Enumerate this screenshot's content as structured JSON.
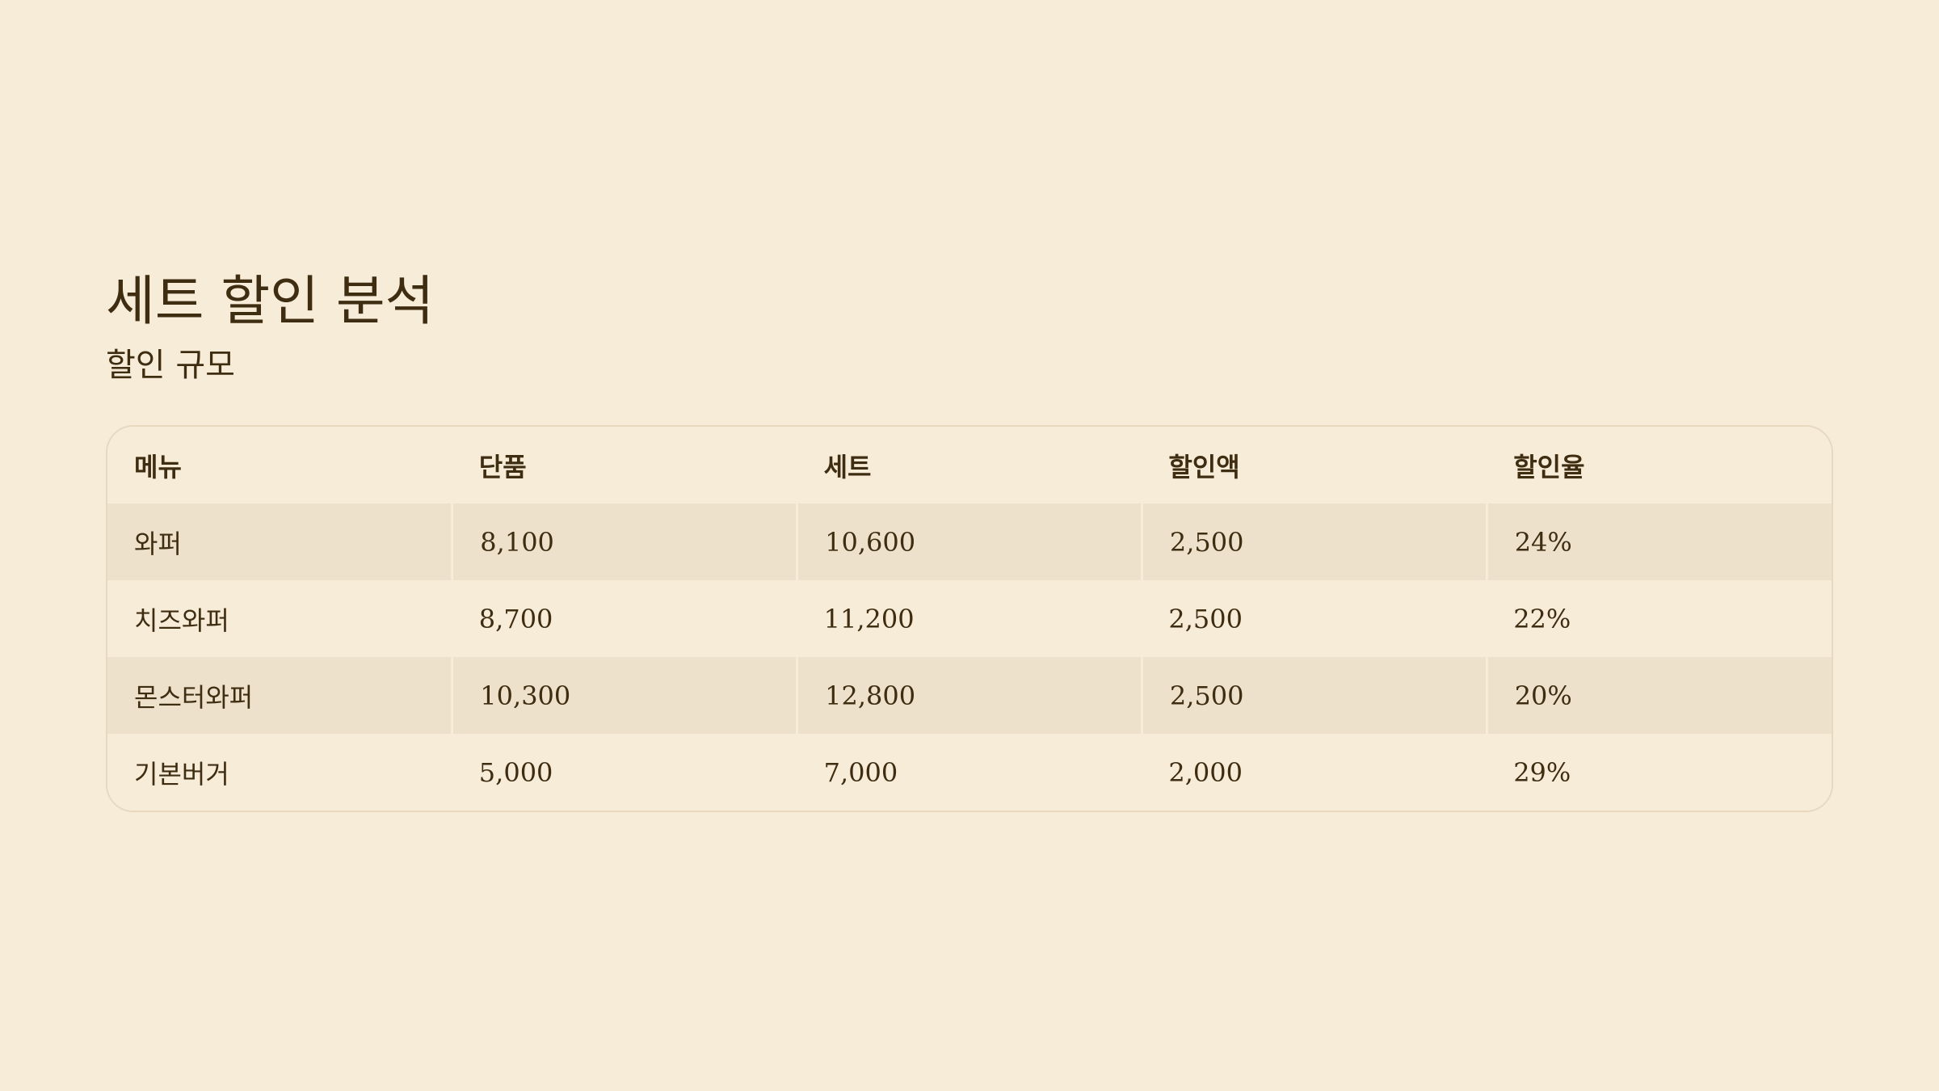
{
  "title": "세트 할인 분석",
  "subtitle": "할인 규모",
  "table": {
    "headers": [
      "메뉴",
      "단품",
      "세트",
      "할인액",
      "할인율"
    ],
    "rows": [
      [
        "와퍼",
        "8,100",
        "10,600",
        "2,500",
        "24%"
      ],
      [
        "치즈와퍼",
        "8,700",
        "11,200",
        "2,500",
        "22%"
      ],
      [
        "몬스터와퍼",
        "10,300",
        "12,800",
        "2,500",
        "20%"
      ],
      [
        "기본버거",
        "5,000",
        "7,000",
        "2,000",
        "29%"
      ]
    ]
  },
  "colors": {
    "background": "#f7ecd8",
    "stripe": "#ede1cb",
    "text": "#3f2d12",
    "border": "#e6d9c0"
  }
}
